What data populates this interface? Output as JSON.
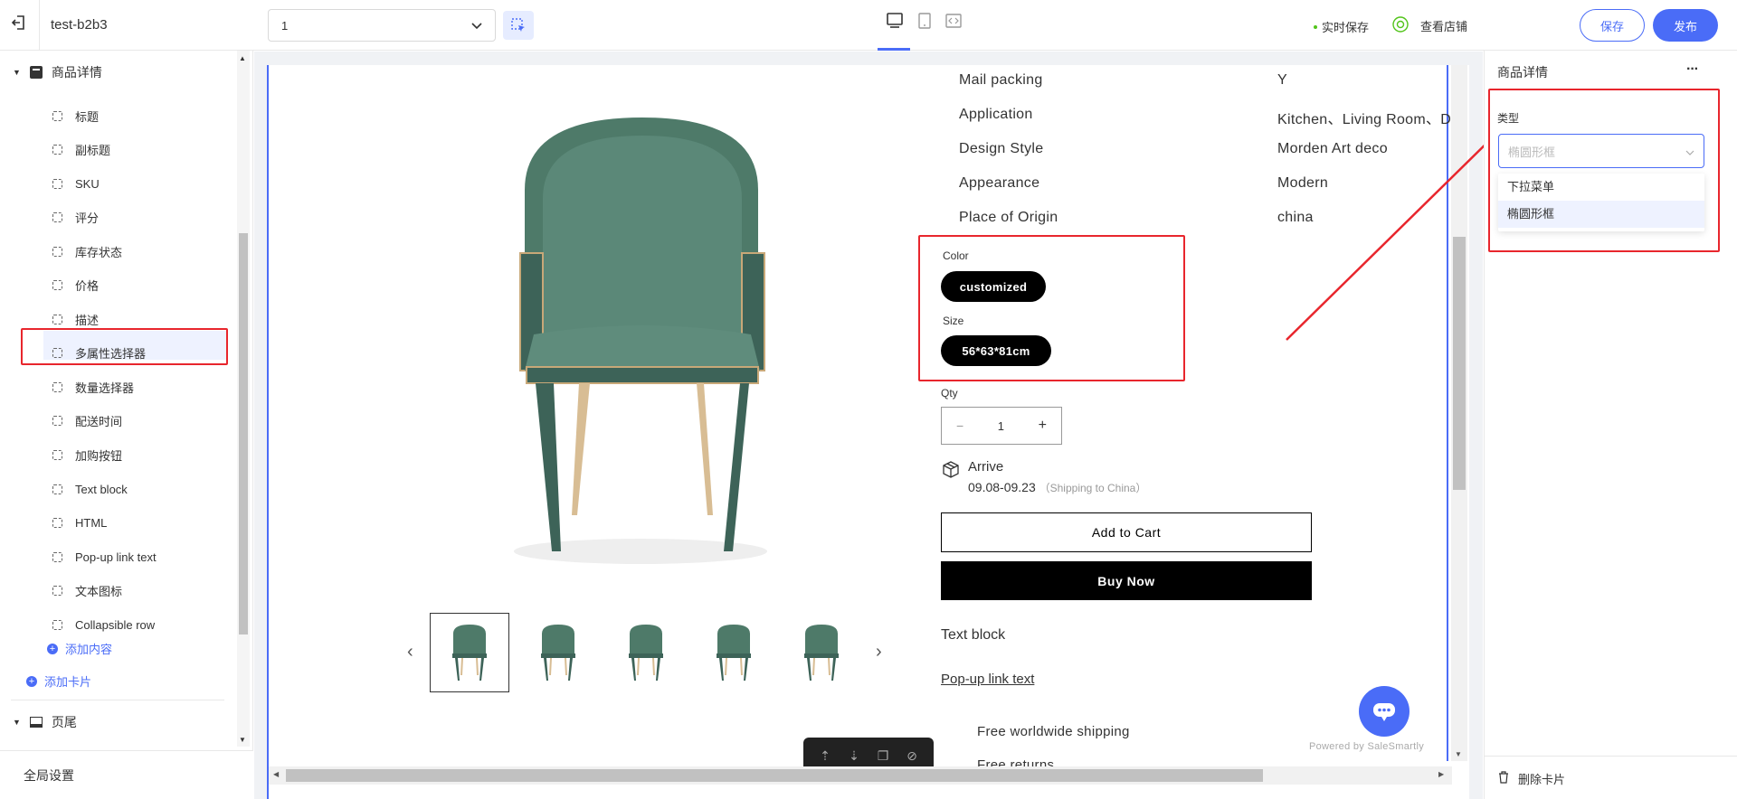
{
  "header": {
    "store_name": "test-b2b3",
    "page_select_value": "1",
    "autosave": "实时保存",
    "view_store": "查看店铺",
    "save_label": "保存",
    "publish_label": "发布"
  },
  "left_panel": {
    "section_title": "商品详情",
    "items": [
      "标题",
      "副标题",
      "SKU",
      "评分",
      "库存状态",
      "价格",
      "描述",
      "多属性选择器",
      "数量选择器",
      "配送时间",
      "加购按钮",
      "Text block",
      "HTML",
      "Pop-up link text",
      "文本图标",
      "Collapsible row"
    ],
    "add_content": "添加内容",
    "add_card": "添加卡片",
    "footer_section": "页尾",
    "global_settings": "全局设置"
  },
  "preview": {
    "specs": [
      {
        "label": "Mail packing",
        "value": "Y"
      },
      {
        "label": "Application",
        "value": "Kitchen、Living Room、Di"
      },
      {
        "label": "Design Style",
        "value": "Morden Art deco"
      },
      {
        "label": "Appearance",
        "value": "Modern"
      },
      {
        "label": "Place of Origin",
        "value": "china"
      }
    ],
    "color_label": "Color",
    "color_value": "customized",
    "size_label": "Size",
    "size_value": "56*63*81cm",
    "qty_label": "Qty",
    "qty_value": "1",
    "qty_minus": "−",
    "qty_plus": "+",
    "arrive_label": "Arrive",
    "arrive_dates": "09.08-09.23",
    "arrive_note": "（Shipping to China）",
    "add_to_cart": "Add to Cart",
    "buy_now": "Buy Now",
    "text_block": "Text block",
    "popup_link": "Pop-up link text",
    "icon_text_1": "Free worldwide shipping",
    "icon_text_2": "Free returns",
    "powered_by": "Powered by SaleSmartly",
    "prev_arrow": "‹",
    "next_arrow": "›"
  },
  "right_panel": {
    "title": "商品详情",
    "more": "···",
    "type_label": "类型",
    "type_select_value": "椭圆形框",
    "options": [
      "下拉菜单",
      "椭圆形框"
    ],
    "delete_card": "删除卡片"
  },
  "colors": {
    "accent": "#4a6cf7",
    "highlight_red": "#e8262d",
    "chair_green": "#4e7a69"
  }
}
